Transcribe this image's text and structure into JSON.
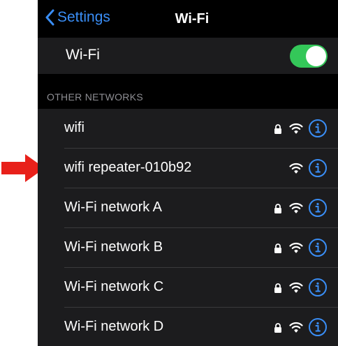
{
  "nav": {
    "back_label": "Settings",
    "title": "Wi-Fi"
  },
  "wifi_toggle": {
    "label": "Wi-Fi",
    "enabled": true
  },
  "section_header": "OTHER NETWORKS",
  "networks": [
    {
      "name": "wifi",
      "secured": true
    },
    {
      "name": "wifi repeater-010b92",
      "secured": false
    },
    {
      "name": "Wi-Fi network A",
      "secured": true
    },
    {
      "name": "Wi-Fi network B",
      "secured": true
    },
    {
      "name": "Wi-Fi network C",
      "secured": true
    },
    {
      "name": "Wi-Fi network D",
      "secured": true
    }
  ],
  "colors": {
    "accent": "#3a8ef6",
    "toggle_on": "#34c759",
    "annotation_arrow": "#e8201a"
  },
  "icons": {
    "back": "chevron-left-icon",
    "lock": "lock-icon",
    "signal": "wifi-signal-icon",
    "info": "info-icon",
    "annotation": "red-arrow-icon"
  }
}
